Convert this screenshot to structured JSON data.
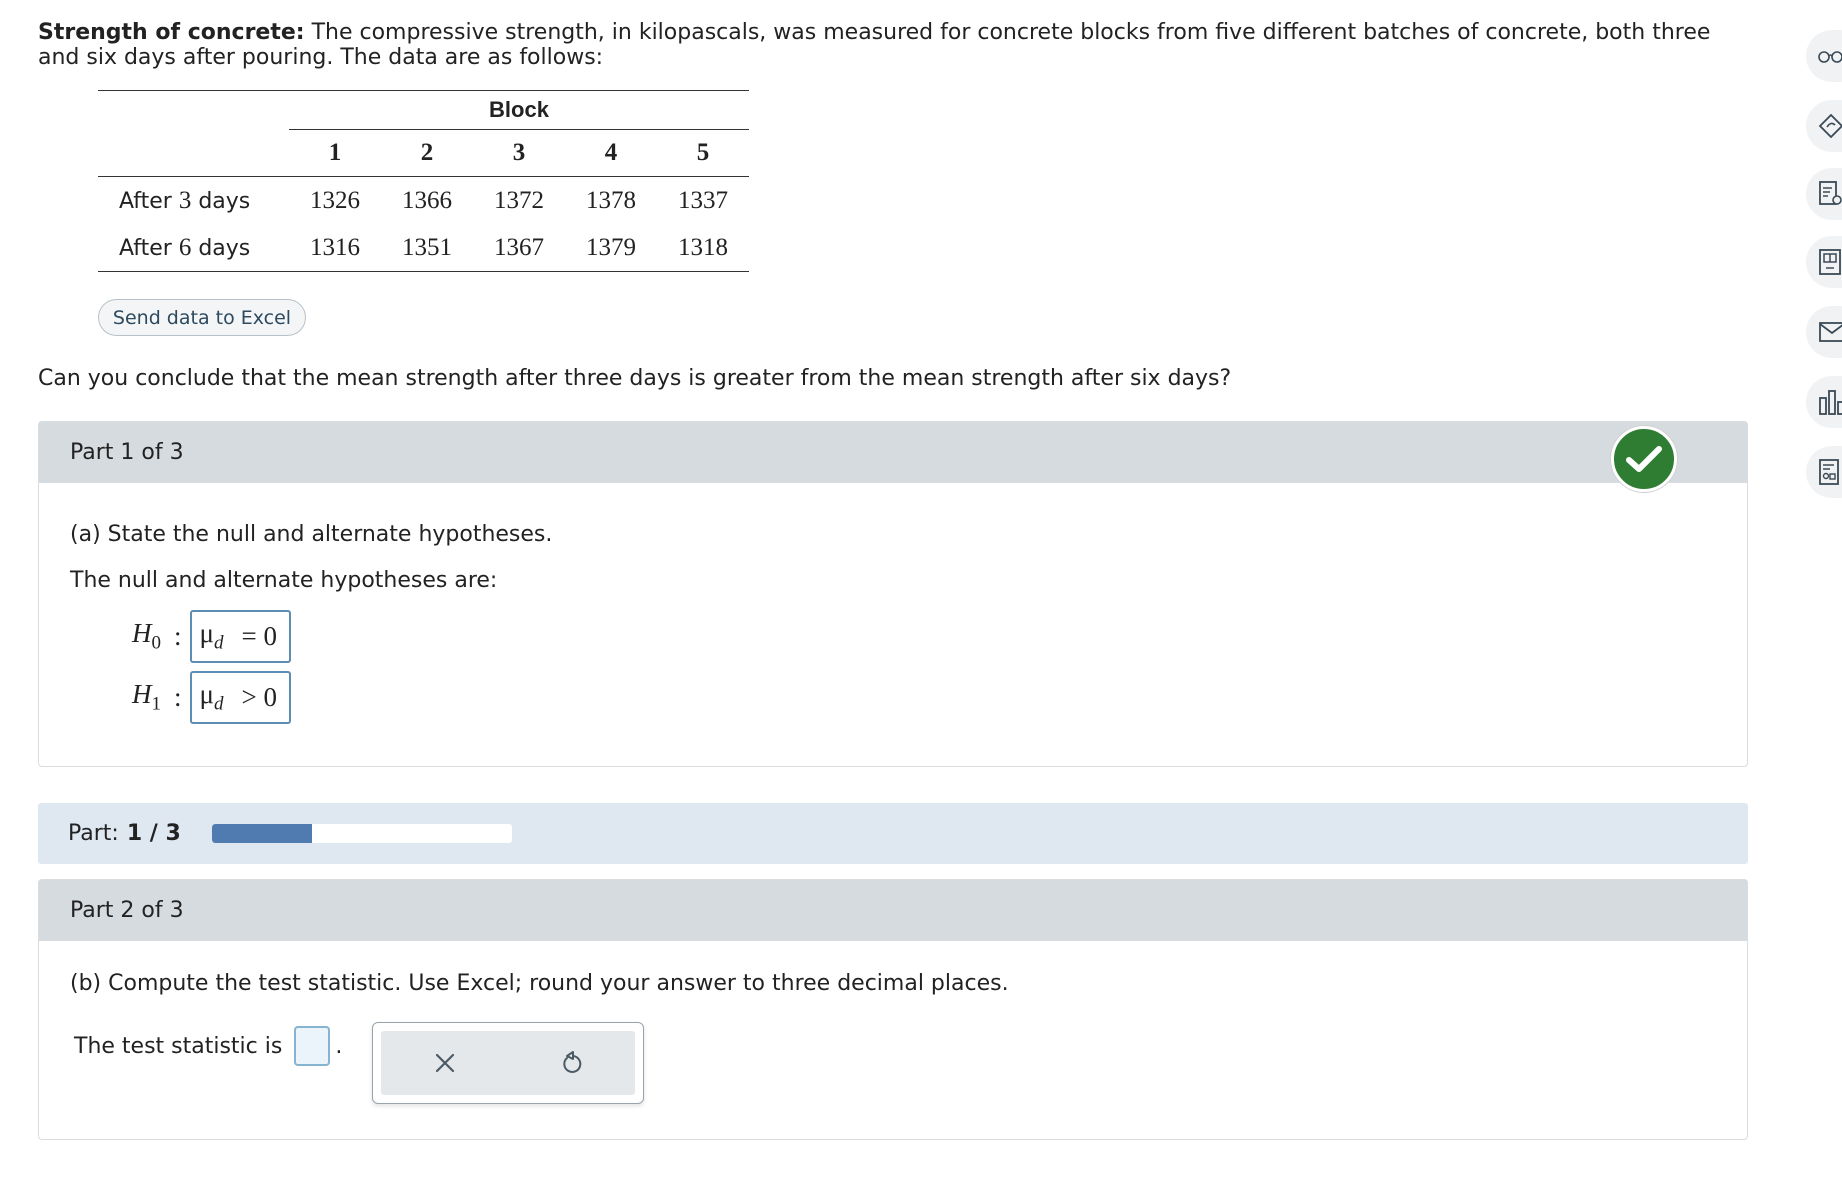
{
  "intro": {
    "title": "Strength of concrete:",
    "text": " The compressive strength, in kilopascals, was measured for concrete blocks from five different batches of concrete, both three and six days after pouring. The data are as follows:"
  },
  "table": {
    "group_header": "Block",
    "columns": [
      "1",
      "2",
      "3",
      "4",
      "5"
    ],
    "rows": [
      {
        "label_pre": "After ",
        "label_num": "3",
        "label_post": " days",
        "values": [
          "1326",
          "1366",
          "1372",
          "1378",
          "1337"
        ]
      },
      {
        "label_pre": "After ",
        "label_num": "6",
        "label_post": " days",
        "values": [
          "1316",
          "1351",
          "1367",
          "1379",
          "1318"
        ]
      }
    ]
  },
  "excel_button": "Send data to Excel",
  "question": "Can you conclude that the mean strength after three days is greater from the mean strength after six days?",
  "part1": {
    "header": "Part 1 of 3",
    "prompt": "(a)  State the null and alternate hypotheses.",
    "subprompt": "The null and alternate hypotheses are:",
    "h0": {
      "name": "H",
      "sub": "0",
      "param": "μ",
      "param_sub": "d",
      "relation": "= 0"
    },
    "h1": {
      "name": "H",
      "sub": "1",
      "param": "μ",
      "param_sub": "d",
      "relation": "> 0"
    },
    "status": "correct"
  },
  "progress": {
    "label": "Part:",
    "value": "1 / 3",
    "fraction": 0.333
  },
  "part2": {
    "header": "Part 2 of 3",
    "prompt": "(b)  Compute the test statistic. Use Excel; round your answer to three decimal places.",
    "stat_label": "The test statistic is",
    "stat_value": "",
    "punct": ".",
    "tools": [
      "close-icon",
      "undo-icon"
    ]
  },
  "colors": {
    "accent": "#4f7bb0",
    "check": "#2e7d32",
    "header_bg": "#d5dbdf",
    "progress_bg": "#dfe8f0"
  }
}
